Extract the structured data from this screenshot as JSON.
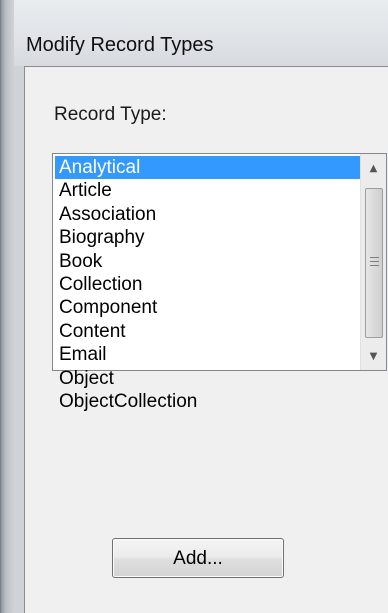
{
  "window": {
    "title": "Modify Record Types"
  },
  "record_type": {
    "label": "Record Type:",
    "selected_index": 0,
    "items": [
      "Analytical",
      "Article",
      "Association",
      "Biography",
      "Book",
      "Collection",
      "Component",
      "Content",
      "Email",
      "Object",
      "ObjectCollection"
    ]
  },
  "scrollbar": {
    "up_icon": "up-arrow-icon",
    "down_icon": "down-arrow-icon",
    "grip_icon": "grip-icon"
  },
  "actions": {
    "add_label": "Add..."
  },
  "colors": {
    "selection": "#3399ff",
    "dialog_background": "#f0f0f0"
  }
}
